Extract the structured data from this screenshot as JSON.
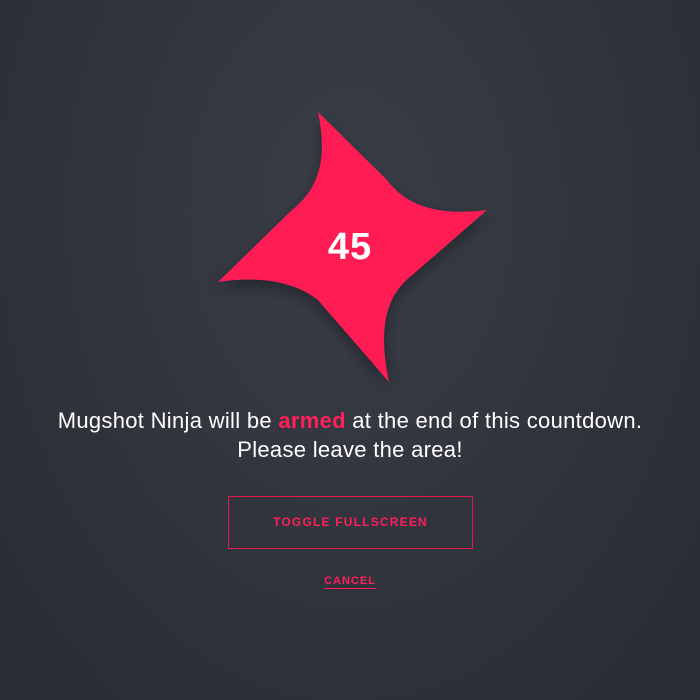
{
  "countdown": {
    "value": "45"
  },
  "message": {
    "line1_before": "Mugshot Ninja will be ",
    "line1_accent": "armed",
    "line1_after": " at the end of this countdown.",
    "line2": "Please leave the area!"
  },
  "actions": {
    "toggle_fullscreen_label": "TOGGLE FULLSCREEN",
    "cancel_label": "CANCEL"
  },
  "colors": {
    "accent": "#ff1f5a",
    "background": "#31343c",
    "text": "#ffffff"
  },
  "icons": {
    "countdown_graphic": "shuriken-icon"
  }
}
